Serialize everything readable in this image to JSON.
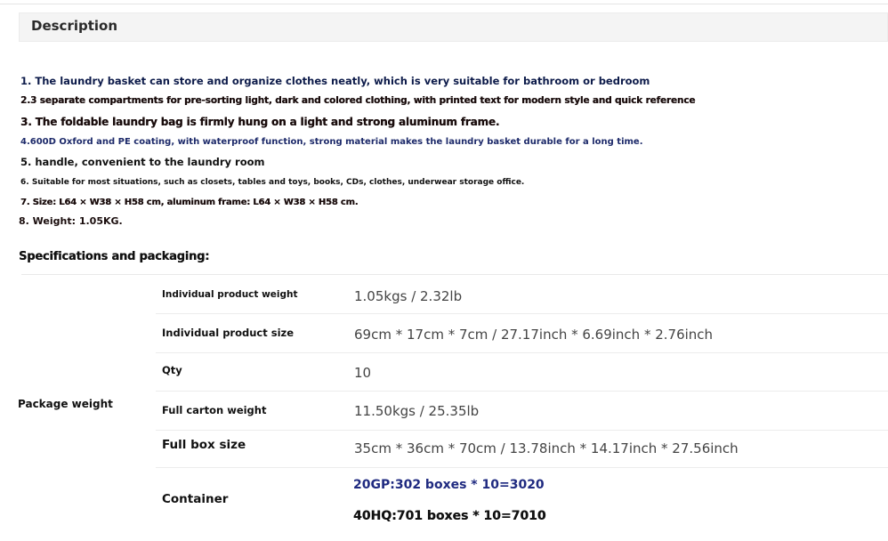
{
  "description": {
    "title": "Description",
    "features": [
      "1. The laundry basket can store and organize clothes neatly, which is very suitable for bathroom or bedroom",
      "2.3 separate compartments for pre-sorting light, dark and colored clothing, with printed text for modern style and quick reference",
      "3. The foldable laundry bag is firmly hung on a light and strong aluminum frame.",
      "4.600D Oxford and PE coating, with waterproof function, strong material makes the laundry basket durable for a long time.",
      "5. handle, convenient to the laundry room",
      "6. Suitable for most situations, such as closets, tables and toys, books, CDs, clothes, underwear storage office.",
      "7. Size: L64 × W38 × H58 cm, aluminum frame: L64 × W38 × H58 cm.",
      "8. Weight: 1.05KG."
    ]
  },
  "specs": {
    "title": "Specifications and packaging:",
    "group_label": "Package weight",
    "rows": [
      {
        "label": "Individual product weight",
        "value": "1.05kgs / 2.32lb"
      },
      {
        "label": "Individual product size",
        "value": "69cm * 17cm * 7cm / 27.17inch * 6.69inch * 2.76inch"
      },
      {
        "label": "Qty",
        "value": "10"
      },
      {
        "label": "Full carton weight",
        "value": "11.50kgs / 25.35lb"
      },
      {
        "label": "Full box size",
        "value": "35cm * 36cm * 70cm / 13.78inch * 14.17inch * 27.56inch"
      }
    ],
    "container": {
      "label": "Container",
      "values": [
        "20GP:302 boxes * 10=3020",
        "40HQ:701 boxes * 10=7010"
      ]
    }
  },
  "colors": {
    "header_bg": "#f4f4f4",
    "navy_text": "#1f2a80",
    "value_text": "#444444"
  }
}
